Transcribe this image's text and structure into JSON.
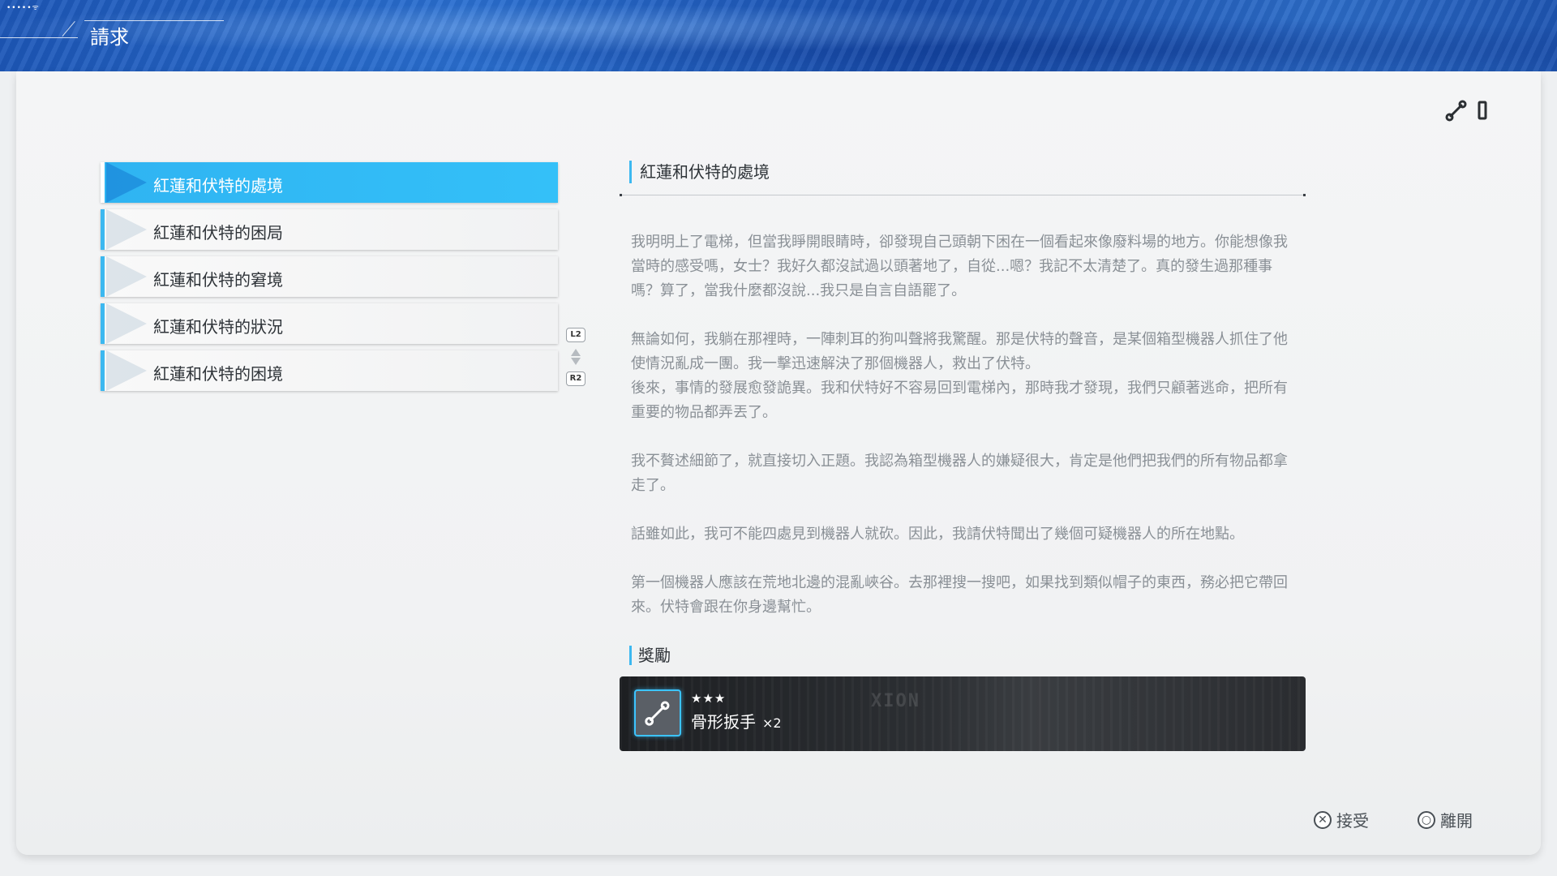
{
  "status": {
    "signal": "•••••ᯤ"
  },
  "header": {
    "title": "請求"
  },
  "quest_list": {
    "items": [
      {
        "label": "紅蓮和伏特的處境",
        "selected": true
      },
      {
        "label": "紅蓮和伏特的困局",
        "selected": false
      },
      {
        "label": "紅蓮和伏特的窘境",
        "selected": false
      },
      {
        "label": "紅蓮和伏特的狀況",
        "selected": false
      },
      {
        "label": "紅蓮和伏特的困境",
        "selected": false
      }
    ],
    "scroll_up_button": "L2",
    "scroll_down_button": "R2"
  },
  "detail": {
    "title": "紅蓮和伏特的處境",
    "paragraphs": [
      "我明明上了電梯，但當我睜開眼睛時，卻發現自己頭朝下困在一個看起來像廢料場的地方。你能想像我當時的感受嗎，女士？我好久都沒試過以頭著地了，自從...嗯？我記不太清楚了。真的發生過那種事嗎？算了，當我什麼都沒說...我只是自言自語罷了。",
      "無論如何，我躺在那裡時，一陣刺耳的狗叫聲將我驚醒。那是伏特的聲音，是某個箱型機器人抓住了他使情況亂成一團。我一擊迅速解決了那個機器人，救出了伏特。\n後來，事情的發展愈發詭異。我和伏特好不容易回到電梯內，那時我才發現，我們只顧著逃命，把所有重要的物品都弄丟了。",
      "我不贅述細節了，就直接切入正題。我認為箱型機器人的嫌疑很大，肯定是他們把我們的所有物品都拿走了。",
      "話雖如此，我可不能四處見到機器人就砍。因此，我請伏特聞出了幾個可疑機器人的所在地點。",
      "第一個機器人應該在荒地北邊的混亂峽谷。去那裡搜一搜吧，如果找到類似帽子的東西，務必把它帶回來。伏特會跟在你身邊幫忙。"
    ],
    "reward_heading": "獎勵",
    "reward": {
      "rarity": "★★★",
      "name": "骨形扳手",
      "quantity": "×2",
      "icon": "bone-wrench-icon",
      "background_logo": "XION"
    }
  },
  "top_right_icons": [
    "bone-wrench-icon",
    "bar-icon"
  ],
  "prompts": {
    "accept": {
      "button": "✕",
      "label": "接受"
    },
    "leave": {
      "button": "○",
      "label": "離開"
    }
  },
  "colors": {
    "accent": "#3cb8f0",
    "selected_bg": "#2fb4f2",
    "banner": "#1d57b8"
  }
}
